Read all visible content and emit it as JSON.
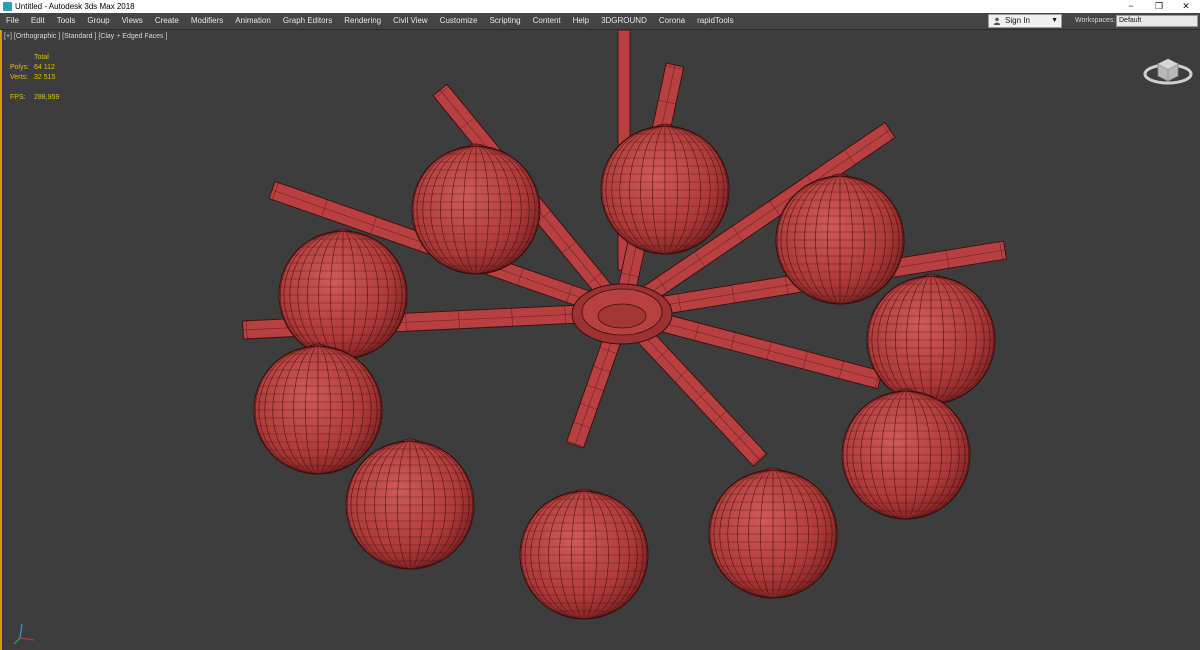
{
  "window": {
    "title": "Untitled - Autodesk 3ds Max 2018",
    "controls": {
      "minimize": "−",
      "maximize": "❐",
      "close": "✕"
    }
  },
  "menu": {
    "items": [
      "File",
      "Edit",
      "Tools",
      "Group",
      "Views",
      "Create",
      "Modifiers",
      "Animation",
      "Graph Editors",
      "Rendering",
      "Civil View",
      "Customize",
      "Scripting",
      "Content",
      "Help",
      "3DGROUND",
      "Corona",
      "rapidTools"
    ],
    "signin": {
      "label": "Sign In",
      "icon": "user-icon"
    },
    "workspaces": {
      "label": "Workspaces:",
      "value": "Default"
    }
  },
  "viewport": {
    "label": "[+] [Orthographic ] [Standard ] [Clay + Edged Faces ]",
    "stats": {
      "header": "Total",
      "polys_label": "Polys:",
      "polys": "64 112",
      "verts_label": "Verts:",
      "verts": "32 515",
      "fps_label": "FPS:",
      "fps": "288,959"
    },
    "colors": {
      "background": "#3d3d3d",
      "clay": "#b94040",
      "wire": "#3a0e0e",
      "stats_text": "#e3c200",
      "active_border": "#d0a000"
    }
  }
}
